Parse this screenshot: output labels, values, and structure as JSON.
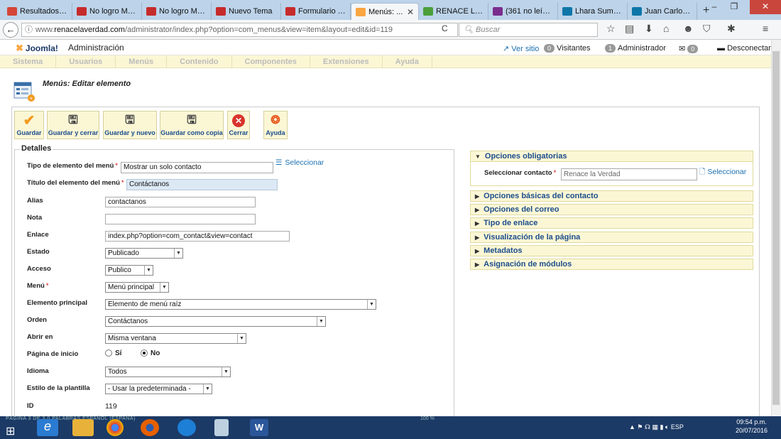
{
  "browser": {
    "tabs": [
      {
        "title": "Resultados d...",
        "icon": "gmail-icon",
        "color": "#d44638"
      },
      {
        "title": "No logro Me...",
        "icon": "site-icon",
        "color": "#c62b2b"
      },
      {
        "title": "No logro Me...",
        "icon": "site-icon",
        "color": "#c62b2b"
      },
      {
        "title": "Nuevo Tema",
        "icon": "site-icon",
        "color": "#c62b2b"
      },
      {
        "title": "Formulario d...",
        "icon": "site-icon",
        "color": "#c62b2b"
      },
      {
        "title": "Menús: ...",
        "icon": "joomla-icon",
        "color": "#f9a541",
        "active": true
      },
      {
        "title": "RENACE LA ...",
        "icon": "renace-icon",
        "color": "#4b9f3b"
      },
      {
        "title": "(361 no leído...",
        "icon": "mail-icon",
        "color": "#7b2d8e"
      },
      {
        "title": "Lhara Sumar...",
        "icon": "linkedin-icon",
        "color": "#0e76a8"
      },
      {
        "title": "Juan Carlos ...",
        "icon": "linkedin-icon",
        "color": "#0e76a8"
      }
    ],
    "url_prefix": "www.",
    "url_domain": "renacelaverdad.com",
    "url_path": "/administrator/index.php?option=com_menus&view=item&layout=edit&id=119",
    "search_placeholder": "Buscar"
  },
  "joomla": {
    "brand": "Joomla!",
    "admin_title": "Administración",
    "ver_sitio": "Ver sitio",
    "visitors_count": "0",
    "visitors_label": "Visitantes",
    "admins_count": "1",
    "admins_label": "Administrador",
    "messages_count": "0",
    "logout": "Desconectar",
    "menu": [
      "Sistema",
      "Usuarios",
      "Menús",
      "Contenido",
      "Componentes",
      "Extensiones",
      "Ayuda"
    ],
    "page_title": "Menús: Editar elemento",
    "toolbar": [
      {
        "label": "Guardar",
        "icon": "check-icon"
      },
      {
        "label": "Guardar y cerrar",
        "icon": "save-close-icon"
      },
      {
        "label": "Guardar y nuevo",
        "icon": "save-new-icon"
      },
      {
        "label": "Guardar como copia",
        "icon": "save-copy-icon"
      },
      {
        "label": "Cerrar",
        "icon": "cancel-icon"
      },
      {
        "label": "Ayuda",
        "icon": "help-icon"
      }
    ]
  },
  "details": {
    "legend": "Detalles",
    "tipo_label": "Tipo de elemento del menú",
    "tipo_value": "Mostrar un solo contacto",
    "seleccionar": "Seleccionar",
    "titulo_label": "Título del elemento del menú",
    "titulo_value": "Contáctanos",
    "alias_label": "Alias",
    "alias_value": "contactanos",
    "nota_label": "Nota",
    "nota_value": "",
    "enlace_label": "Enlace",
    "enlace_value": "index.php?option=com_contact&view=contact",
    "estado_label": "Estado",
    "estado_value": "Publicado",
    "acceso_label": "Acceso",
    "acceso_value": "Publico",
    "menu_label": "Menú",
    "menu_value": "Menú principal",
    "principal_label": "Elemento principal",
    "principal_value": "Elemento de menú raíz",
    "orden_label": "Orden",
    "orden_value": "Contáctanos",
    "abrir_label": "Abrir en",
    "abrir_value": "Misma ventana",
    "inicio_label": "Página de inicio",
    "inicio_si": "Sí",
    "inicio_no": "No",
    "idioma_label": "Idioma",
    "idioma_value": "Todos",
    "estilo_label": "Estilo de la plantilla",
    "estilo_value": "- Usar la predeterminada -",
    "id_label": "ID",
    "id_value": "119"
  },
  "options": {
    "required_title": "Opciones obligatorias",
    "contact_label": "Seleccionar contacto",
    "contact_value": "Renace la Verdad",
    "contact_select": "Seleccionar",
    "panels": [
      "Opciones básicas del contacto",
      "Opciones del correo",
      "Tipo de enlace",
      "Visualización de la página",
      "Metadatos",
      "Asignación de módulos"
    ]
  },
  "taskbar": {
    "status_text": "PÁGINA 3 DE 3    0 PALABRAS    ESPAÑOL (ESPAÑA)",
    "zoom": "100 %",
    "lang": "ESP",
    "time": "09:54 p.m.",
    "date": "20/07/2016"
  }
}
